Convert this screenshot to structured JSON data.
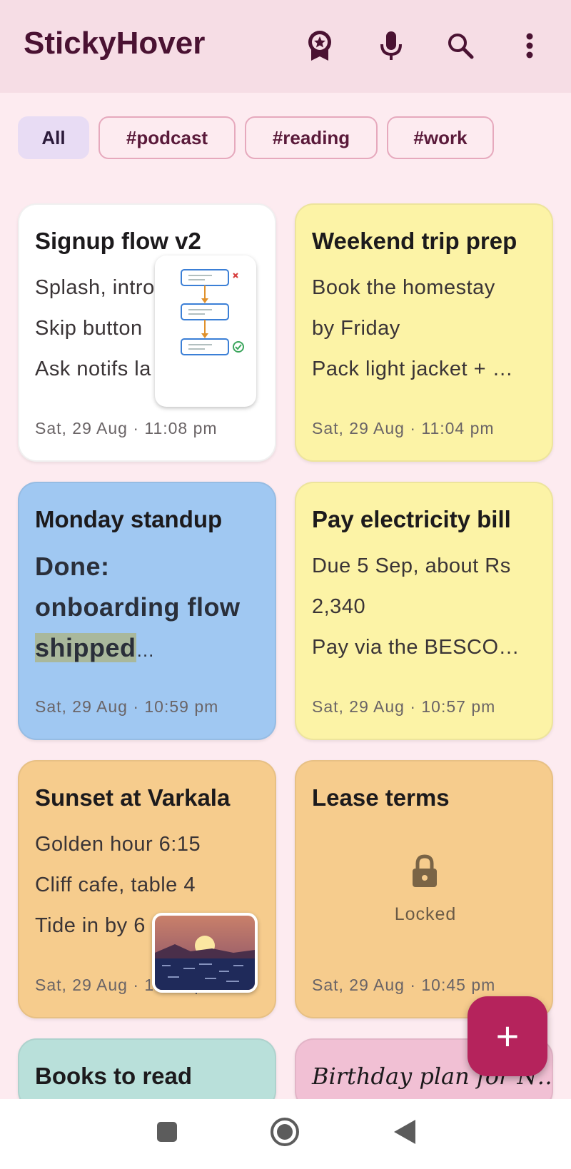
{
  "app": {
    "title": "StickyHover"
  },
  "appbar": {
    "icons": [
      "award-icon",
      "mic-icon",
      "search-icon",
      "more-vert-icon"
    ]
  },
  "filters": [
    {
      "label": "All",
      "active": true
    },
    {
      "label": "#podcast",
      "active": false
    },
    {
      "label": "#reading",
      "active": false
    },
    {
      "label": "#work",
      "active": false
    }
  ],
  "notes": [
    {
      "title": "Signup flow v2",
      "lines": [
        "Splash, intro",
        "Skip button",
        "Ask notifs la"
      ],
      "date": "Sat, 29 Aug · 11:08 pm",
      "color": "#ffffff"
    },
    {
      "title": "Weekend trip prep",
      "lines": [
        "Book the homestay",
        "by Friday",
        "Pack light jacket + …"
      ],
      "date": "Sat, 29 Aug · 11:04 pm",
      "color": "#fcf3a6"
    },
    {
      "title": "Monday standup",
      "lines": [
        "Done:",
        "onboarding flow",
        "shipped",
        "…"
      ],
      "date": "Sat, 29 Aug · 10:59 pm",
      "color": "#a0c8f2"
    },
    {
      "title": "Pay electricity bill",
      "lines": [
        "Due 5 Sep, about Rs",
        "2,340",
        "Pay via the BESCO…"
      ],
      "date": "Sat, 29 Aug · 10:57 pm",
      "color": "#fcf3a6"
    },
    {
      "title": "Sunset at Varkala",
      "lines": [
        "Golden hour 6:15",
        "Cliff cafe, table 4",
        "Tide in by 6"
      ],
      "date": "Sat, 29 Aug · 10:57 pm",
      "color": "#f6cc8d"
    },
    {
      "title": "Lease terms",
      "locked_label": "Locked",
      "date": "Sat, 29 Aug · 10:45 pm",
      "color": "#f6cc8d"
    },
    {
      "title": "Books to read",
      "color": "#b9e0da"
    },
    {
      "title": "Birthday plan for N…",
      "color": "#f1c0d4"
    }
  ],
  "fab": {
    "label": "+"
  },
  "navbar": {
    "icons": [
      "recents-icon",
      "home-icon",
      "back-icon"
    ]
  }
}
